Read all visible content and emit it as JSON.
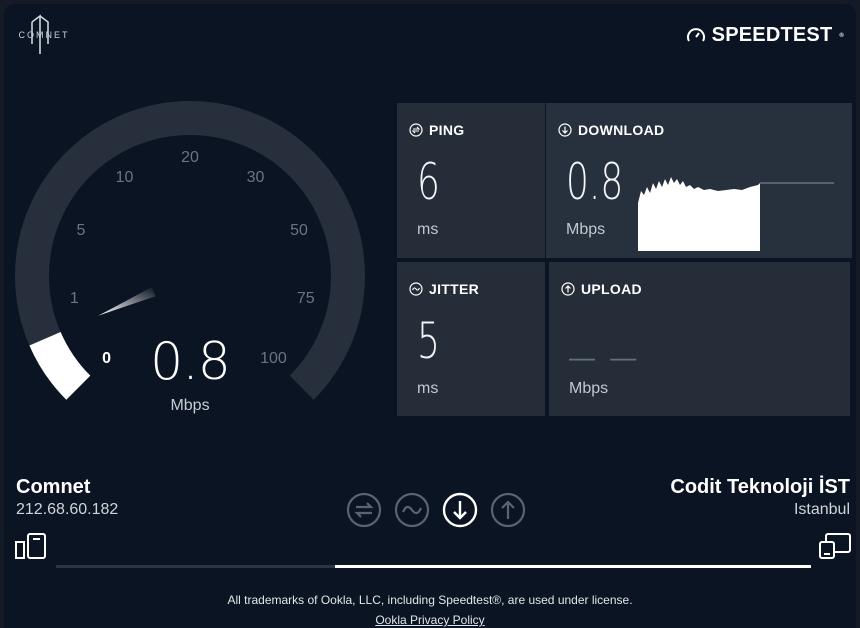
{
  "provider": {
    "logo_text": "COMNET"
  },
  "brand": {
    "name": "SPEEDTEST"
  },
  "gauge": {
    "ticks": [
      "0",
      "1",
      "5",
      "10",
      "20",
      "30",
      "50",
      "75",
      "100"
    ],
    "value": "0.8",
    "unit": "Mbps",
    "level": 0.08
  },
  "ping": {
    "label": "PING",
    "value": "6",
    "unit": "ms"
  },
  "download": {
    "label": "DOWNLOAD",
    "value": "0.8",
    "unit": "Mbps"
  },
  "jitter": {
    "label": "JITTER",
    "value": "5",
    "unit": "ms"
  },
  "upload": {
    "label": "UPLOAD",
    "value": "— —",
    "unit": "Mbps"
  },
  "isp": {
    "name": "Comnet",
    "ip": "212.68.60.182"
  },
  "server": {
    "name": "Codit Teknoloji İST",
    "location": "Istanbul"
  },
  "test_progress": 0.63,
  "footer": {
    "trademark": "All trademarks of Ookla, LLC, including Speedtest®, are used under license.",
    "privacy_link": "Ookla Privacy Policy"
  },
  "colors": {
    "background": "#0b1422",
    "card": "#252d39",
    "arc": "#262f3b",
    "accent": "#ffffff"
  },
  "icons": [
    "comnet-logo-icon",
    "speedometer-icon",
    "ping-icon",
    "download-icon",
    "jitter-icon",
    "upload-icon",
    "device-icon",
    "server-icon"
  ]
}
